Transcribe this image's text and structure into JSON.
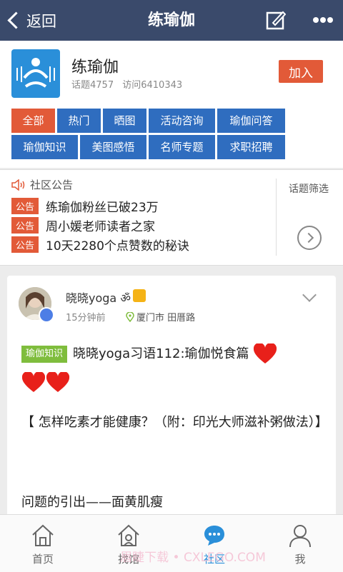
{
  "topbar": {
    "back_label": "返回",
    "title": "练瑜伽"
  },
  "community": {
    "name": "练瑜伽",
    "topics": "话题4757",
    "visits": "访问6410343",
    "join_label": "加入",
    "tabs": [
      "全部",
      "热门",
      "晒图",
      "活动咨询",
      "瑜伽问答",
      "瑜伽知识",
      "美图感悟",
      "名师专题",
      "求职招聘"
    ]
  },
  "notice": {
    "title": "社区公告",
    "badge": "公告",
    "items": [
      "练瑜伽粉丝已破23万",
      "周小媛老师读者之家",
      "10天2280个点赞数的秘诀"
    ],
    "filter_label": "话题筛选"
  },
  "post": {
    "username": "晓晓yoga",
    "time": "15分钟前",
    "location": "厦门市 田厝路",
    "tag": "瑜伽知识",
    "title": "晓晓yoga习语112:瑜伽悦食篇",
    "body1": "【 怎样吃素才能健康？（附：印光大师滋补粥做法）】",
    "body2": "问题的引出——面黄肌瘦"
  },
  "nav": {
    "items": [
      "首页",
      "找馆",
      "社区",
      "我"
    ],
    "active_index": 2
  },
  "watermark": "眉睫下载 • CXLEGO.COM",
  "colors": {
    "topbar": "#3a4a6b",
    "accent": "#e25a38",
    "tab": "#2f6dbf",
    "tag": "#7fbd3d",
    "active_nav": "#2a8fd9"
  }
}
